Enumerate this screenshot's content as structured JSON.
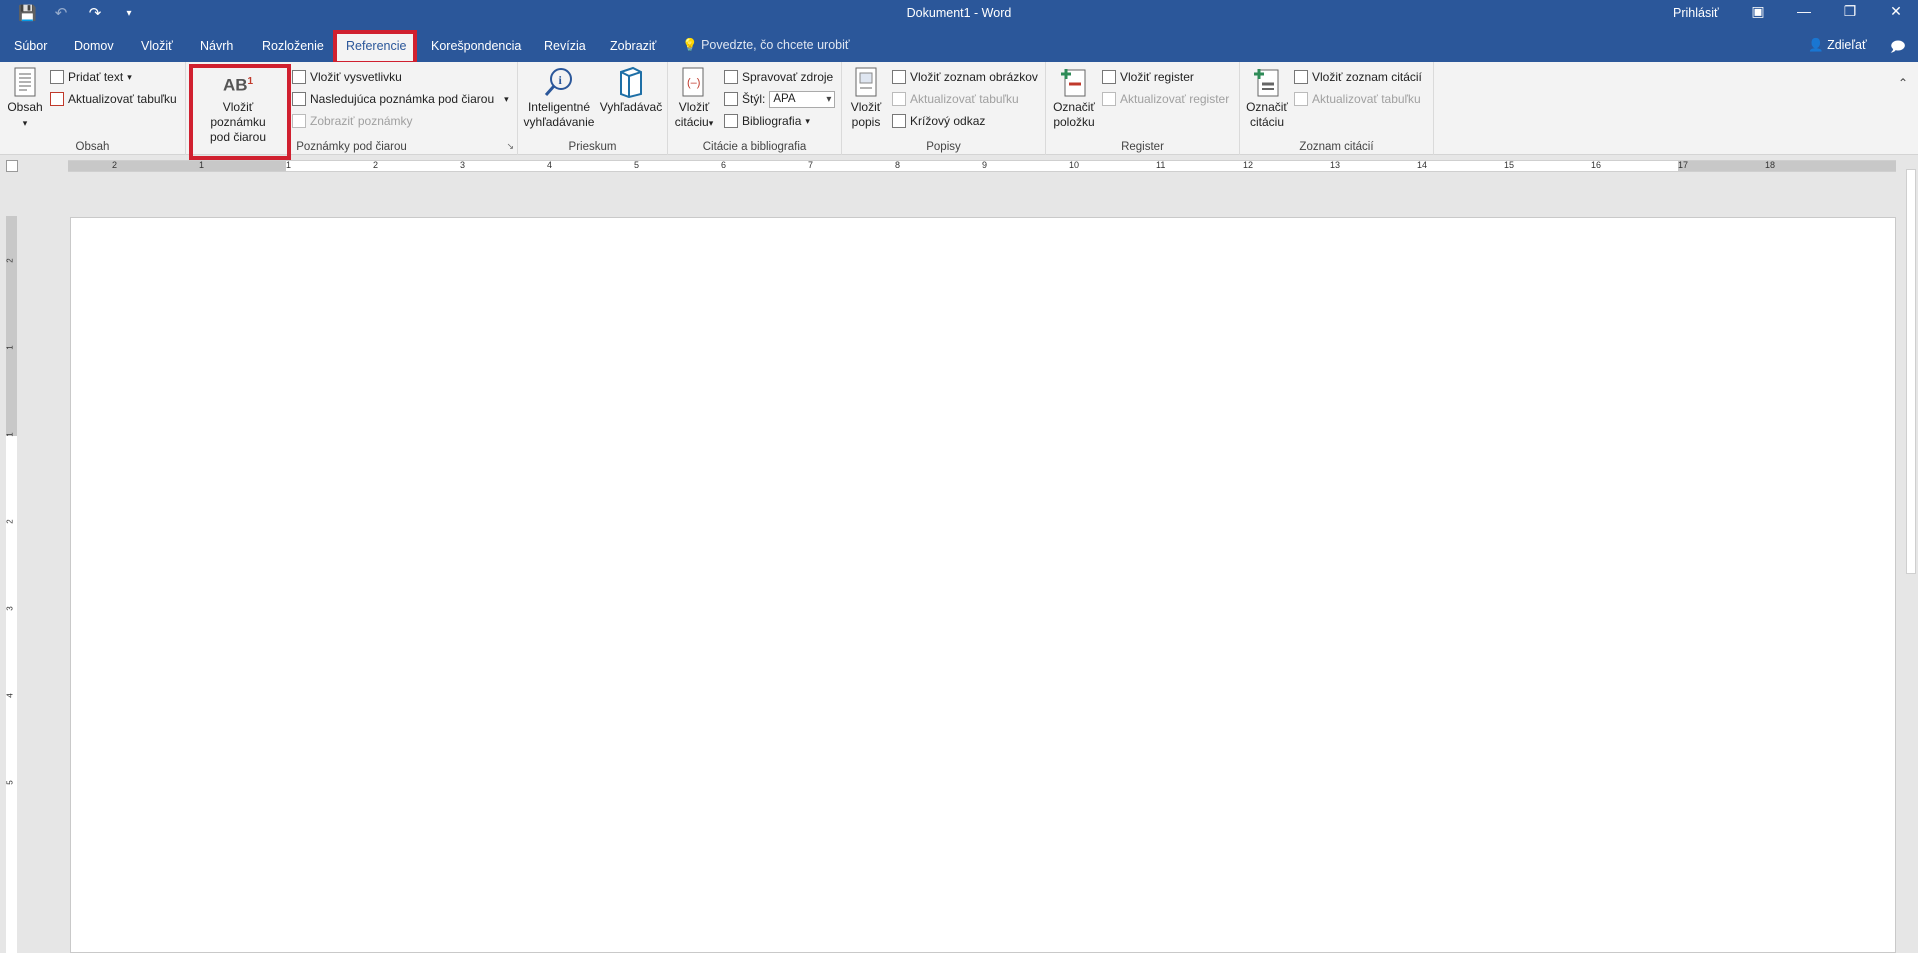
{
  "window": {
    "title": "Dokument1  -  Word",
    "signin": "Prihlásiť"
  },
  "tabs": [
    "Súbor",
    "Domov",
    "Vložiť",
    "Návrh",
    "Rozloženie",
    "Referencie",
    "Korešpondencia",
    "Revízia",
    "Zobraziť"
  ],
  "active_tab": "Referencie",
  "tellme": "Povedzte, čo chcete urobiť",
  "share": "Zdieľať",
  "ribbon": {
    "obsah": {
      "label": "Obsah",
      "big": "Obsah",
      "add_text": "Pridať text",
      "update_table": "Aktualizovať tabuľku"
    },
    "footnotes": {
      "label": "Poznámky pod čiarou",
      "insert_line1": "Vložiť poznámku",
      "insert_line2": "pod čiarou",
      "insert_endnote": "Vložiť vysvetlivku",
      "next_footnote": "Nasledujúca poznámka pod čiarou",
      "show_notes": "Zobraziť poznámky",
      "icon_text": "AB",
      "icon_sup": "1"
    },
    "prieskum": {
      "label": "Prieskum",
      "smart_line1": "Inteligentné",
      "smart_line2": "vyhľadávanie",
      "researcher": "Vyhľadávač"
    },
    "citations": {
      "label": "Citácie a bibliografia",
      "insert_line1": "Vložiť",
      "insert_line2": "citáciu",
      "manage": "Spravovať zdroje",
      "style_label": "Štýl:",
      "style_value": "APA",
      "bibliography": "Bibliografia"
    },
    "captions": {
      "label": "Popisy",
      "insert_line1": "Vložiť",
      "insert_line2": "popis",
      "table_of_figures": "Vložiť zoznam obrázkov",
      "update_table": "Aktualizovať tabuľku",
      "cross_ref": "Krížový odkaz"
    },
    "index": {
      "label": "Register",
      "mark_line1": "Označiť",
      "mark_line2": "položku",
      "insert_index": "Vložiť register",
      "update_index": "Aktualizovať register"
    },
    "toa": {
      "label": "Zoznam citácií",
      "mark_line1": "Označiť",
      "mark_line2": "citáciu",
      "insert_toa": "Vložiť zoznam citácií",
      "update_table": "Aktualizovať tabuľku"
    }
  },
  "ruler": {
    "h_numbers": [
      "2",
      "1",
      "1",
      "2",
      "3",
      "4",
      "5",
      "6",
      "7",
      "8",
      "9",
      "10",
      "11",
      "12",
      "13",
      "14",
      "15",
      "16",
      "17",
      "18"
    ],
    "v_numbers": [
      "2",
      "1",
      "1",
      "2",
      "3",
      "4",
      "5"
    ]
  }
}
